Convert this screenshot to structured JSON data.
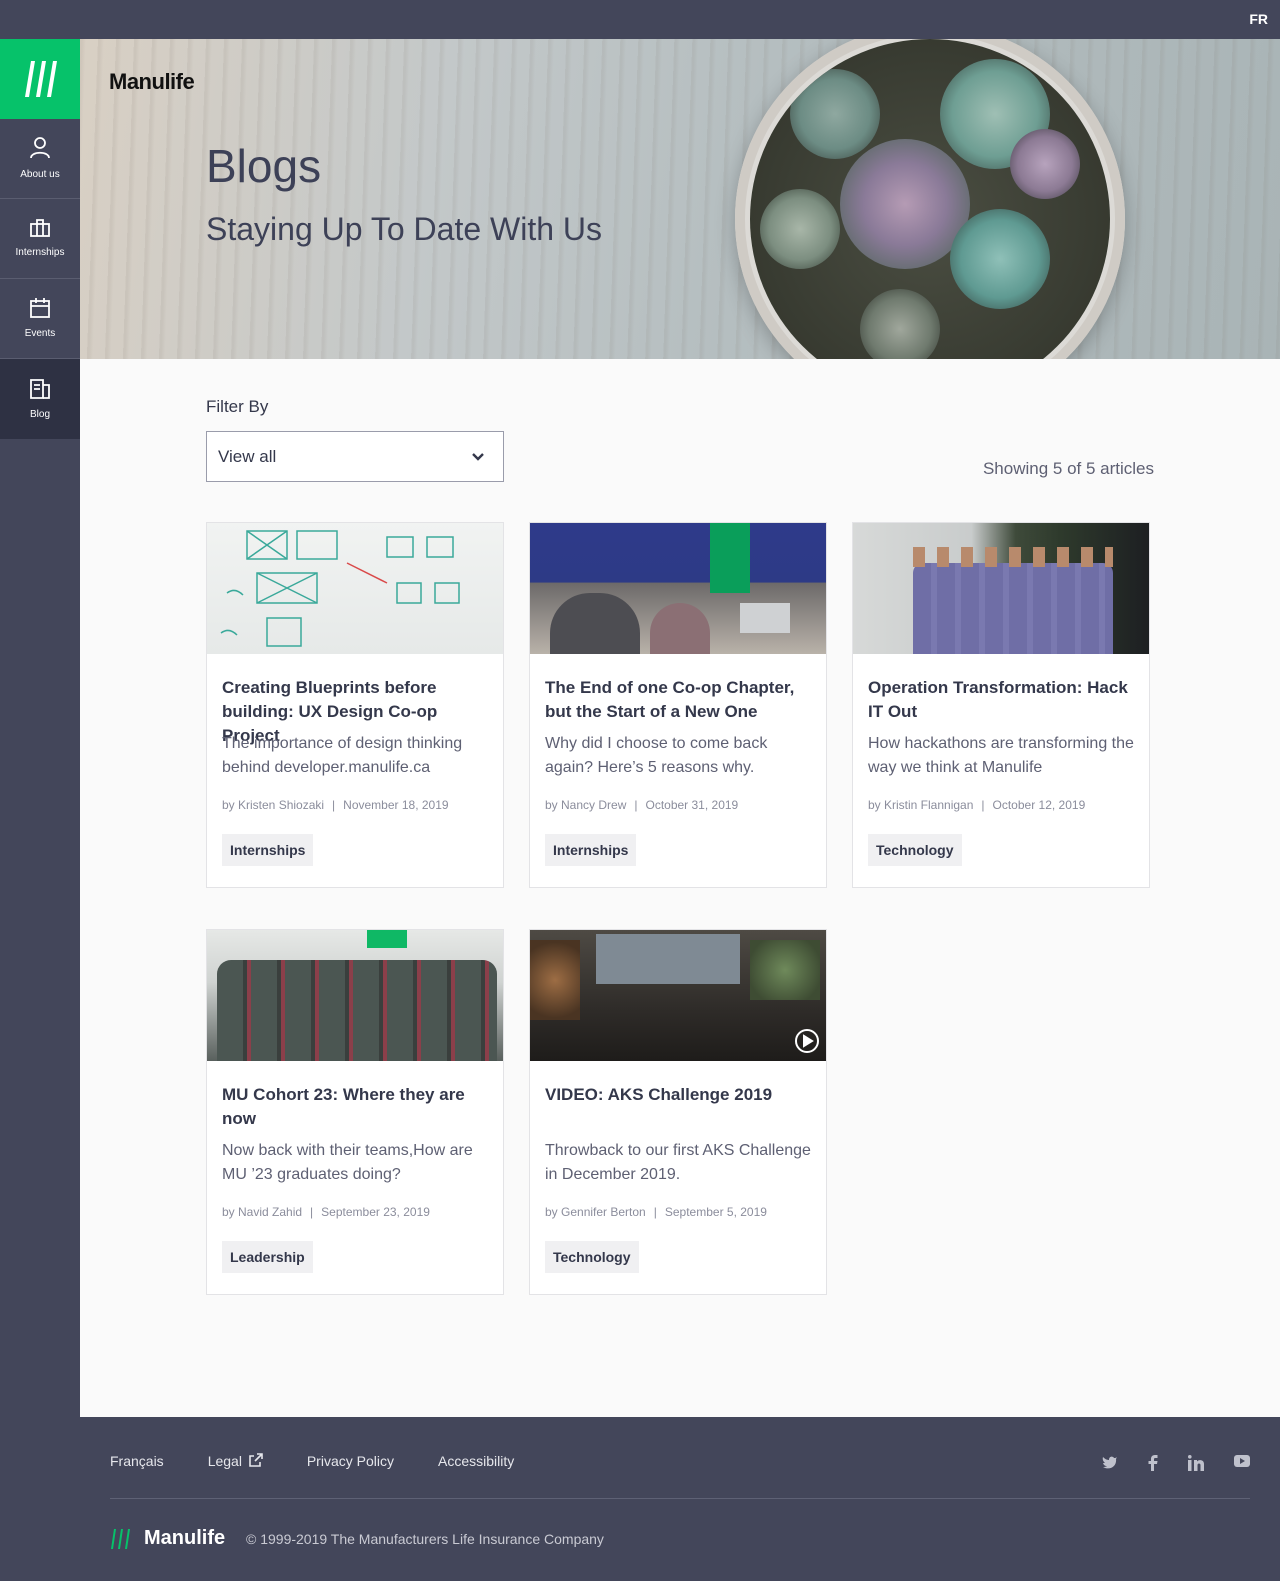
{
  "topbar": {
    "lang_toggle": "FR"
  },
  "sidebar": {
    "items": [
      {
        "label": "About us",
        "icon": "user-icon"
      },
      {
        "label": "Internships",
        "icon": "briefcase-icon"
      },
      {
        "label": "Events",
        "icon": "calendar-icon"
      },
      {
        "label": "Blog",
        "icon": "blog-icon",
        "active": true
      }
    ]
  },
  "hero": {
    "brand": "Manulife",
    "title": "Blogs",
    "subtitle": "Staying Up To Date With Us"
  },
  "filter": {
    "label": "Filter By",
    "selected": "View all"
  },
  "results": {
    "count_text": "Showing 5 of 5 articles"
  },
  "articles": [
    {
      "title": "Creating Blueprints before building: UX Design Co-op Project",
      "description": "The importance of design thinking behind developer.manulife.ca",
      "author": "by Kristen Shiozaki",
      "date": "November 18, 2019",
      "tag": "Internships"
    },
    {
      "title": "The End of one Co-op Chapter, but the Start of a New One",
      "description": "Why did I choose to come back again? Here’s 5 reasons why.",
      "author": "by Nancy Drew",
      "date": "October 31, 2019",
      "tag": "Internships"
    },
    {
      "title": "Operation Transformation: Hack IT Out",
      "description": "How hackathons are transforming the way we think at Manulife",
      "author": "by Kristin Flannigan",
      "date": "October 12, 2019",
      "tag": "Technology"
    },
    {
      "title": "MU Cohort 23: Where they are now",
      "description": "Now back with their teams,How are MU ’23 graduates doing?",
      "author": "by Navid Zahid",
      "date": "September 23, 2019",
      "tag": "Leadership"
    },
    {
      "title": "VIDEO: AKS Challenge 2019",
      "description": "Throwback to our first AKS Challenge in December 2019.",
      "author": "by Gennifer Berton",
      "date": "September 5, 2019",
      "tag": "Technology"
    }
  ],
  "footer": {
    "links": [
      "Français",
      "Legal",
      "Privacy Policy",
      "Accessibility"
    ],
    "social": [
      "twitter-icon",
      "facebook-icon",
      "linkedin-icon",
      "youtube-icon"
    ],
    "brand": "Manulife",
    "copyright": "© 1999-2019 The Manufacturers Life Insurance Company"
  },
  "colors": {
    "brand_green": "#06c26a",
    "nav_dark": "#43465a",
    "nav_active": "#2e3143",
    "text": "#34384b"
  }
}
